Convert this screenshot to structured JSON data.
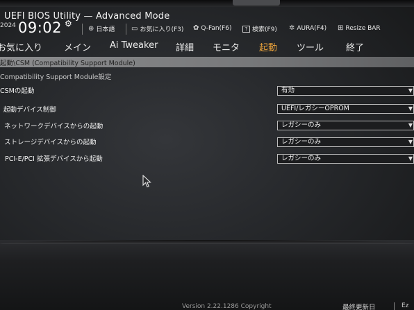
{
  "header": {
    "title": "UEFI BIOS Utility — Advanced Mode",
    "year": "2024",
    "time": "09:02",
    "toolbar": [
      {
        "icon": "globe-icon",
        "label": "日本語"
      },
      {
        "icon": "bookmark-icon",
        "label": "お気に入り(F3)"
      },
      {
        "icon": "fan-icon",
        "label": "Q-Fan(F6)"
      },
      {
        "icon": "help-icon",
        "label": "検索(F9)"
      },
      {
        "icon": "aura-icon",
        "label": "AURA(F4)"
      },
      {
        "icon": "resize-bar-icon",
        "label": "Resize BAR"
      }
    ]
  },
  "menu": {
    "tabs": [
      "お気に入り",
      "メイン",
      "Ai Tweaker",
      "詳細",
      "モニタ",
      "起動",
      "ツール",
      "終了"
    ],
    "active": "起動"
  },
  "breadcrumb": "起動\\CSM (Compatibility Support Module)",
  "section_title": "Compatibility Support Module設定",
  "settings": [
    {
      "label": "CSMの起動",
      "value": "有効"
    },
    {
      "label": "起動デバイス制御",
      "value": "UEFI/レガシーOPROM"
    },
    {
      "label": "ネットワークデバイスからの起動",
      "value": "レガシーのみ"
    },
    {
      "label": "ストレージデバイスからの起動",
      "value": "レガシーのみ"
    },
    {
      "label": "PCI-E/PCI 拡張デバイスから起動",
      "value": "レガシーのみ"
    }
  ],
  "footer": {
    "version": "Version 2.22.1286 Copyright",
    "last_modified": "最終更新日",
    "ez_mode": "Ez"
  },
  "colors": {
    "accent": "#e9a13a",
    "breadcrumb_bg": "#8c8d8f",
    "background": "#26282b"
  }
}
